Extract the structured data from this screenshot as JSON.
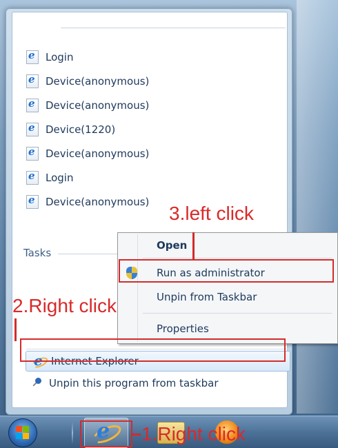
{
  "jump_list": {
    "recent_items": [
      {
        "label": "Login",
        "icon": "ie-document-icon"
      },
      {
        "label": "Device(anonymous)",
        "icon": "ie-document-icon"
      },
      {
        "label": "Device(anonymous)",
        "icon": "ie-document-icon"
      },
      {
        "label": "Device(1220)",
        "icon": "ie-document-icon"
      },
      {
        "label": "Device(anonymous)",
        "icon": "ie-document-icon"
      },
      {
        "label": "Login",
        "icon": "ie-document-icon"
      },
      {
        "label": "Device(anonymous)",
        "icon": "ie-document-icon"
      }
    ],
    "tasks_header": "Tasks",
    "pinned_app": "Internet Explorer",
    "unpin_label": "Unpin this program from taskbar"
  },
  "context_menu": {
    "items": [
      "Open",
      "Run as administrator",
      "Unpin from Taskbar",
      "Properties"
    ]
  },
  "annotations": {
    "step1": "1.Right click",
    "step2": "2.Right click",
    "step3": "3.left click",
    "color": "#d32b2b"
  },
  "taskbar": {
    "icons": [
      "start-orb-icon",
      "internet-explorer-icon",
      "folder-icon",
      "media-player-icon"
    ]
  }
}
